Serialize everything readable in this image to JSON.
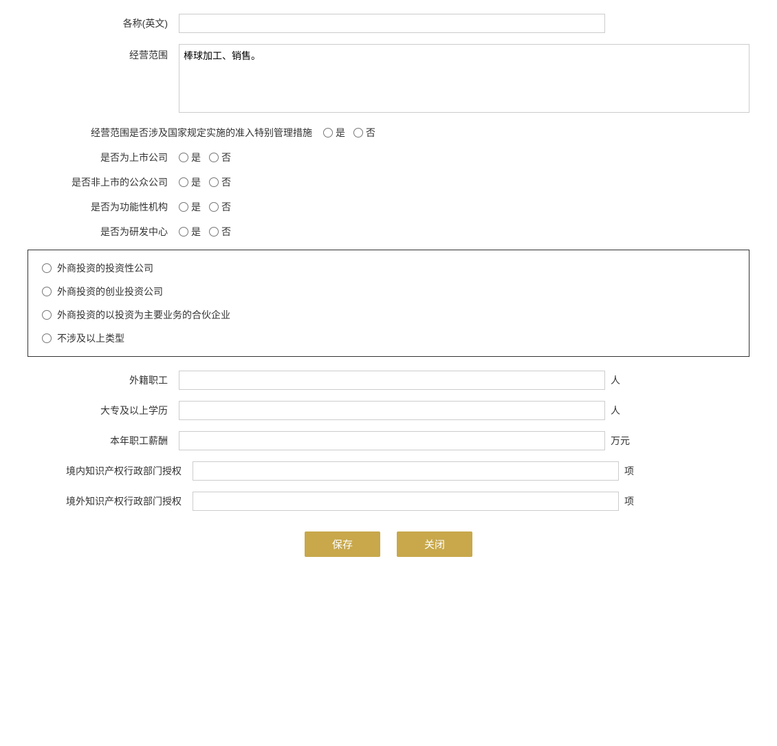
{
  "form": {
    "fields": {
      "name_en_label": "各称(英文)",
      "business_scope_label": "经营范围",
      "business_scope_value": "棒球加工、销售。",
      "special_management_label": "经营范围是否涉及国家规定实施的准入特别管理措施",
      "listed_company_label": "是否为上市公司",
      "non_listed_public_label": "是否非上市的公众公司",
      "functional_org_label": "是否为功能性机构",
      "rd_center_label": "是否为研发中心",
      "foreign_employee_label": "外籍职工",
      "foreign_employee_unit": "人",
      "college_degree_label": "大专及以上学历",
      "college_degree_unit": "人",
      "annual_salary_label": "本年职工薪酬",
      "annual_salary_unit": "万元",
      "domestic_ip_label": "境内知识产权行政部门授权",
      "domestic_ip_unit": "项",
      "foreign_ip_label": "境外知识产权行政部门授权",
      "foreign_ip_unit": "项"
    },
    "radio_options": {
      "yes": "是",
      "no": "否"
    },
    "investment_types": [
      "外商投资的投资性公司",
      "外商投资的创业投资公司",
      "外商投资的以投资为主要业务的合伙企业",
      "不涉及以上类型"
    ],
    "buttons": {
      "save": "保存",
      "close": "关闭"
    }
  }
}
